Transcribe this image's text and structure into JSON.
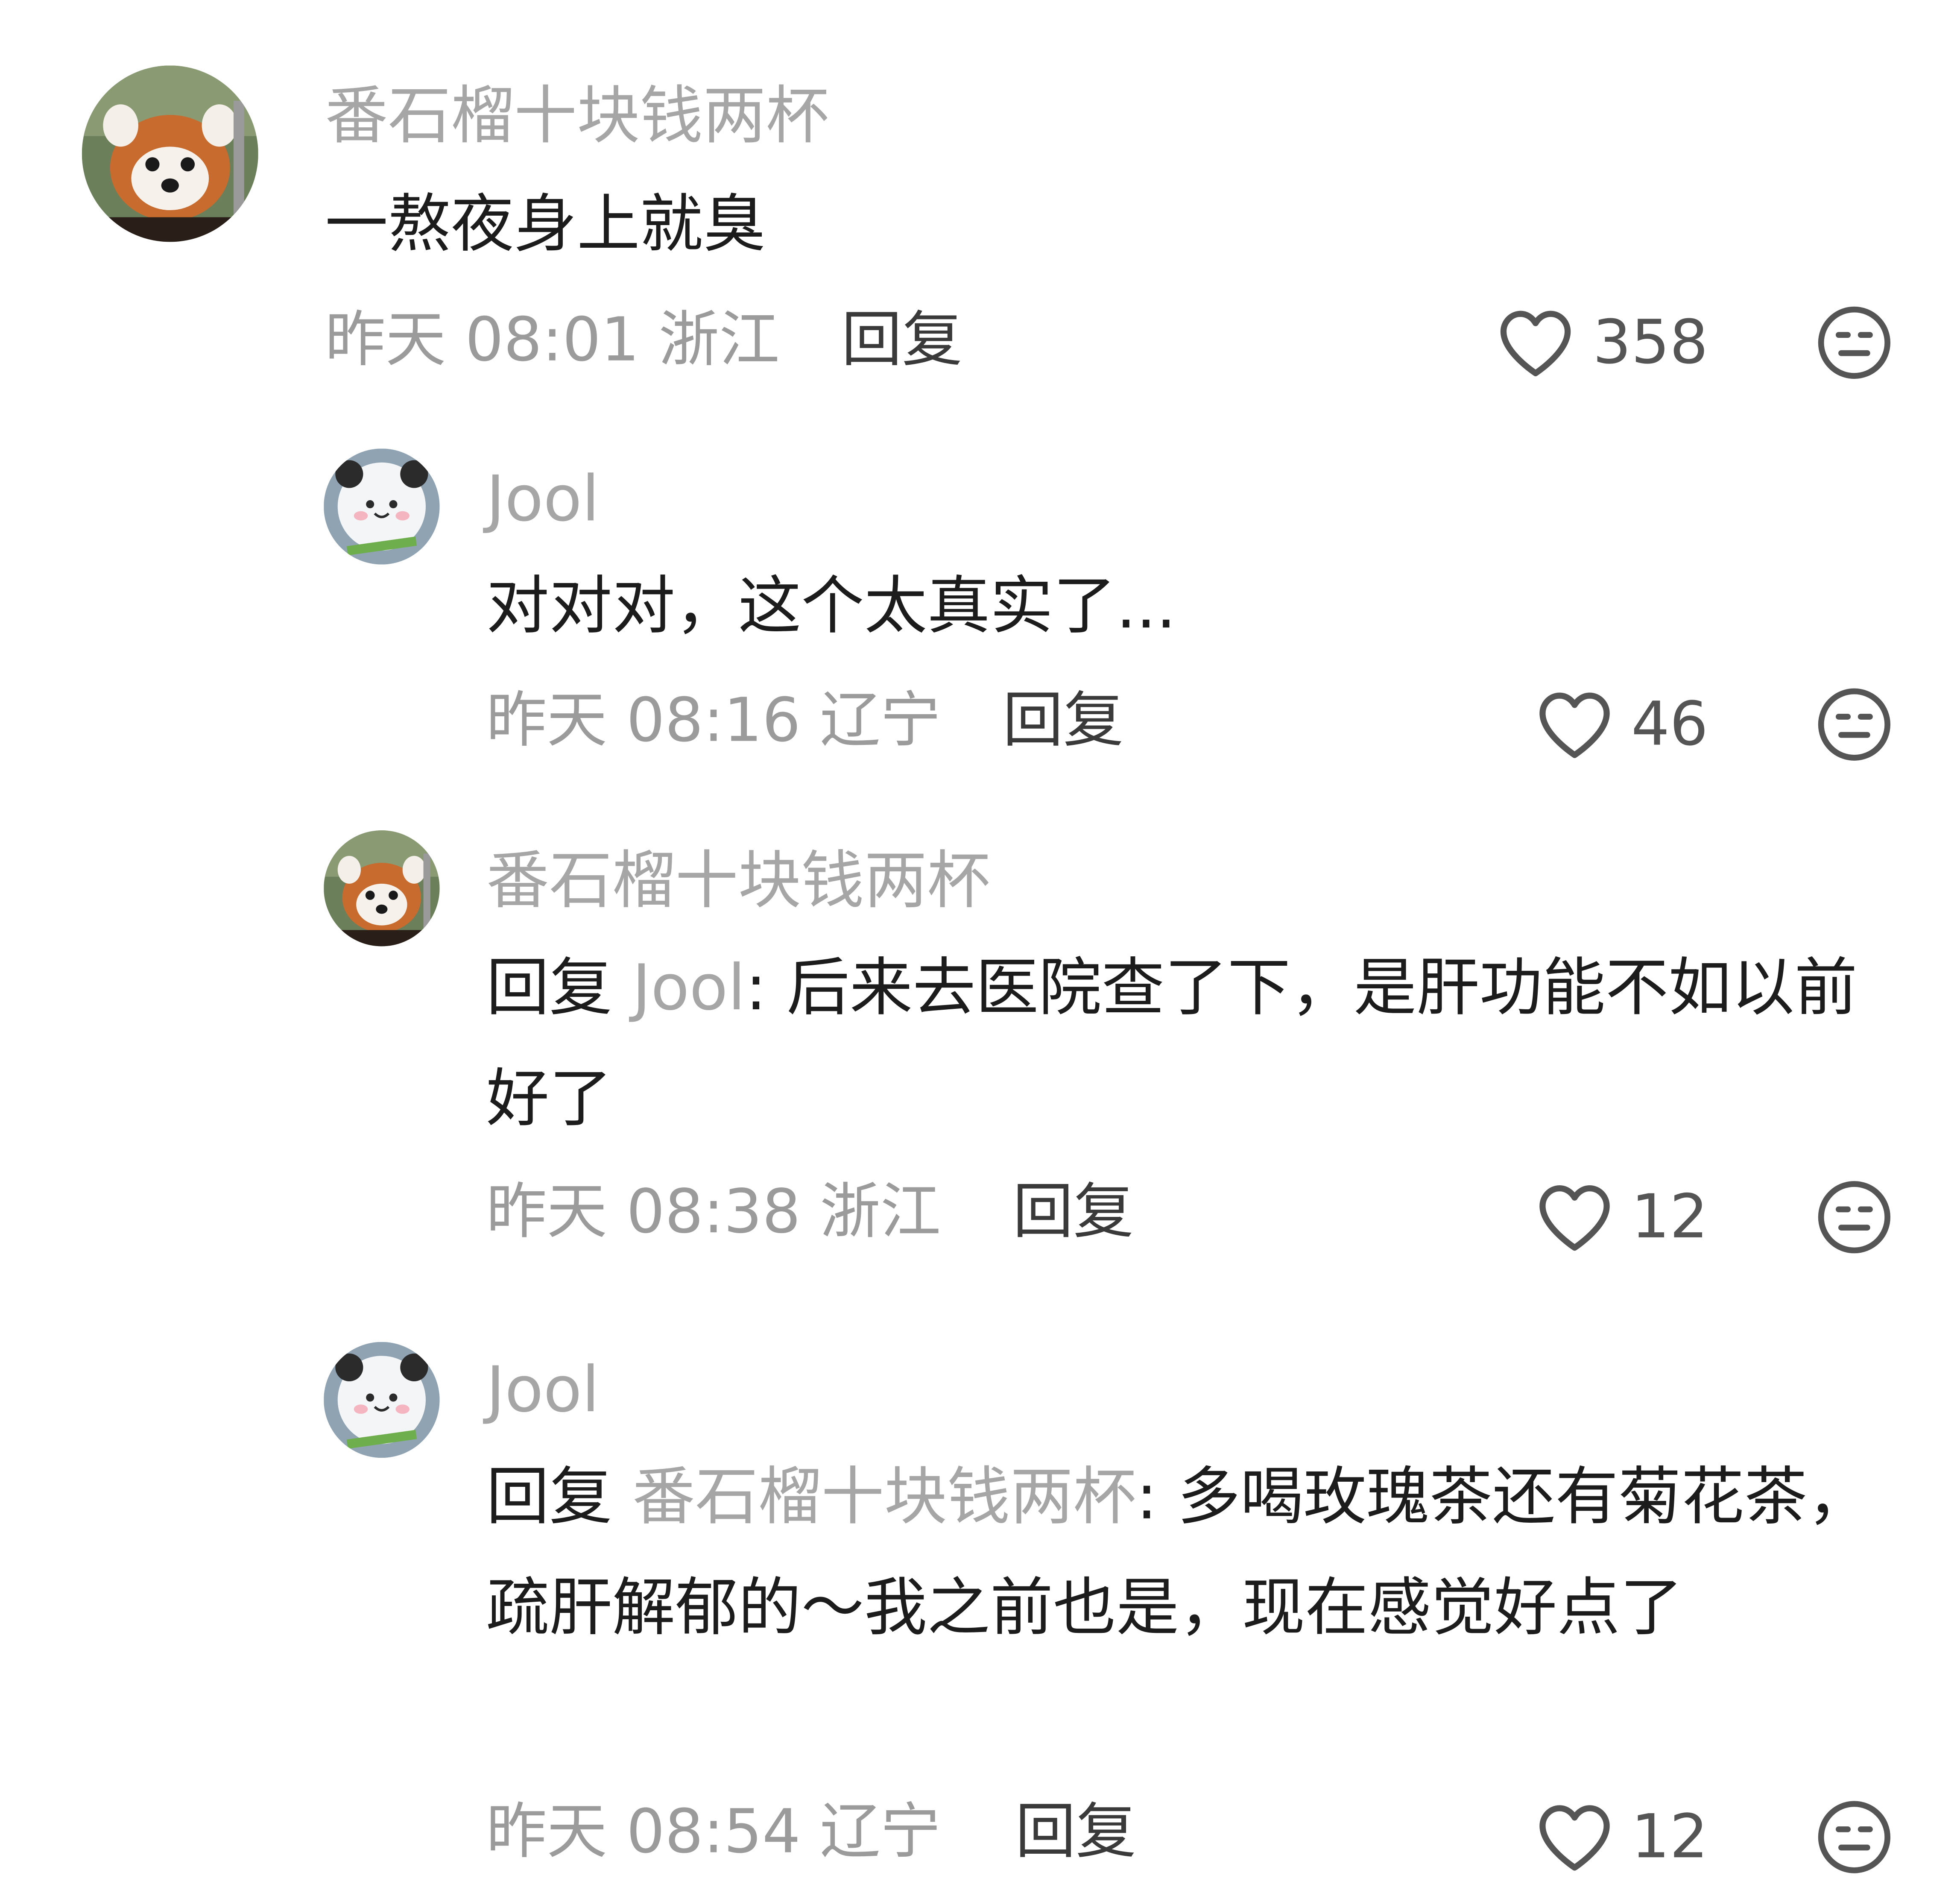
{
  "comments": [
    {
      "username": "番石榴十块钱两杯",
      "avatar_icon": "red-panda-avatar",
      "text": "一熬夜身上就臭",
      "meta": "昨天 08:01 浙江",
      "reply_label": "回复",
      "likes": "358"
    },
    {
      "username": "Jool",
      "avatar_icon": "panda-doll-avatar",
      "text": "对对对，这个太真实了...",
      "meta": "昨天 08:16 辽宁",
      "reply_label": "回复",
      "likes": "46"
    },
    {
      "username": "番石榴十块钱两杯",
      "avatar_icon": "red-panda-avatar",
      "reply_prefix": "回复 ",
      "reply_to": "Jool",
      "text": ": 后来去医院查了下，是肝功能不如以前好了",
      "meta": "昨天 08:38 浙江",
      "reply_label": "回复",
      "likes": "12"
    },
    {
      "username": "Jool",
      "avatar_icon": "panda-doll-avatar",
      "reply_prefix": "回复 ",
      "reply_to": "番石榴十块钱两杯",
      "text": ": 多喝玫瑰茶还有菊花茶，疏肝解郁的～我之前也是，现在感觉好点了",
      "meta": "昨天 08:54 辽宁",
      "reply_label": "回复",
      "likes": "12"
    }
  ],
  "icons": {
    "like": "heart-outline-icon",
    "dislike": "meh-face-icon"
  },
  "colors": {
    "username": "#a6a6a6",
    "text": "#1c1c1c",
    "meta": "#9b9b9b",
    "icon": "#555555"
  }
}
